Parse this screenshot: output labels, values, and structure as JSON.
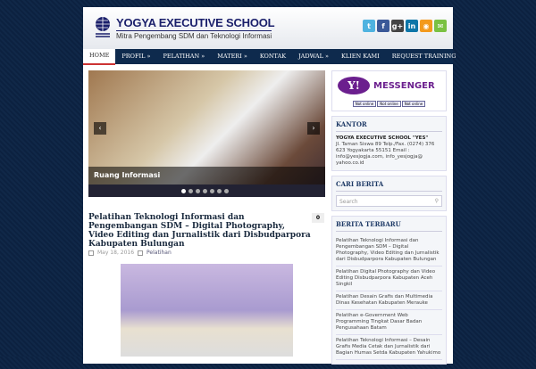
{
  "header": {
    "title": "YOGYA EXECUTIVE SCHOOL",
    "tagline": "Mitra Pengembang SDM dan Teknologi Informasi",
    "social": [
      {
        "name": "twitter-icon",
        "glyph": "t",
        "color": "#4fb3e0"
      },
      {
        "name": "facebook-icon",
        "glyph": "f",
        "color": "#3b5998"
      },
      {
        "name": "google-plus-icon",
        "glyph": "g+",
        "color": "#444"
      },
      {
        "name": "linkedin-icon",
        "glyph": "in",
        "color": "#0e76a8"
      },
      {
        "name": "rss-icon",
        "glyph": "◉",
        "color": "#f39a1d"
      },
      {
        "name": "email-icon",
        "glyph": "✉",
        "color": "#7ac142"
      }
    ]
  },
  "nav": [
    "HOME",
    "PROFIL »",
    "PELATIHAN »",
    "MATERI »",
    "KONTAK",
    "JADWAL »",
    "KLIEN KAMI",
    "REQUEST TRAINING"
  ],
  "slider": {
    "caption": "Ruang Informasi",
    "prev": "‹",
    "next": "›"
  },
  "post": {
    "title": "Pelatihan Teknologi Informasi dan Pengembangan SDM – Digital Photography, Video Editing dan Jurnalistik dari Disbudparpora Kabupaten Bulungan",
    "comments": "0",
    "date": "May 18, 2016",
    "category": "Pelatihan"
  },
  "sidebar": {
    "messenger": {
      "logo": "Y!",
      "label": "MESSENGER",
      "status": [
        "Not online",
        "Not online",
        "Not online"
      ]
    },
    "kantor": {
      "title": "KANTOR",
      "name": "YOGYA EXECUTIVE SCHOOL \"YES\"",
      "address": "Jl. Taman Siswa 89 Telp./Fax. (0274) 376 623 Yogyakarta 55151 Email : info@yesjogja.com, info_yesjogja@ yahoo.co.id"
    },
    "search": {
      "title": "CARI BERITA",
      "placeholder": "Search"
    },
    "recent": {
      "title": "BERITA TERBARU",
      "items": [
        "Pelatihan Teknologi Informasi dan Pengembangan SDM – Digital Photography, Video Editing dan Jurnalistik dari Disbudparpora Kabupaten Bulungan",
        "Pelatihan Digital Photography dan Video Editing Disbudparpora Kabupaten Aceh Singkil",
        "Pelatihan Desain Grafis dan Multimedia Dinas Kesehatan Kabupaten Merauke",
        "Pelatihan e-Government Web Programming Tingkat Dasar Badan Pengusahaan Batam",
        "Pelatihan Teknologi Informasi – Desain Grafis Media Cetak dan Jurnalistik dari Bagian Humas Setda Kabupaten Yahukimo"
      ]
    }
  }
}
